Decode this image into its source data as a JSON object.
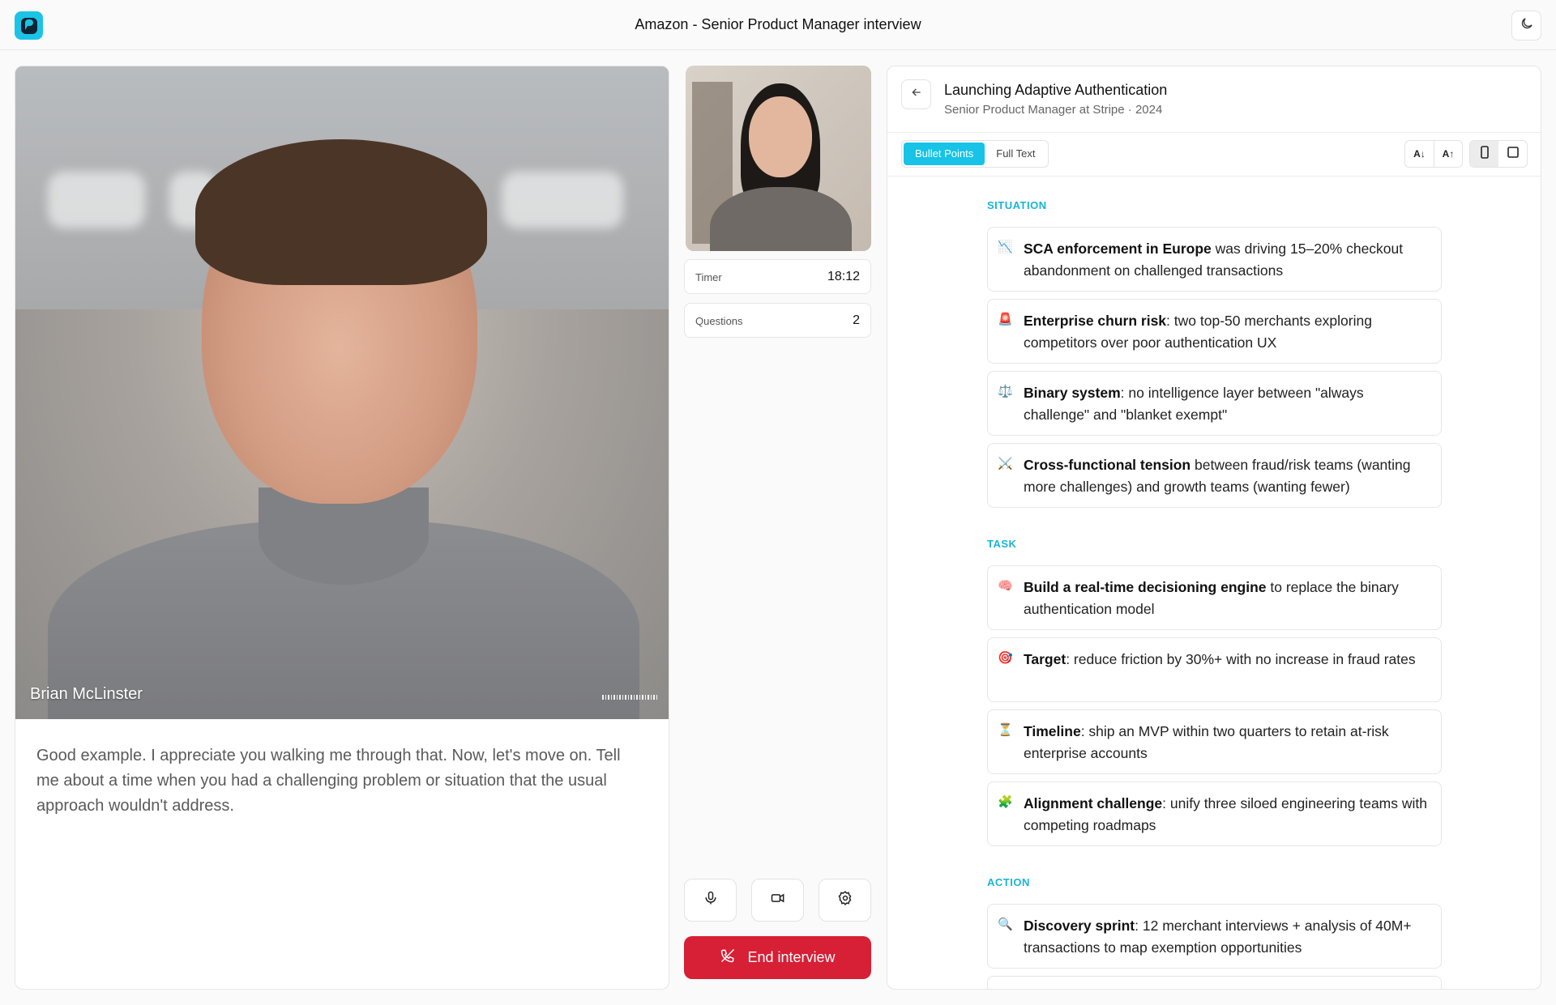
{
  "app": {
    "title": "Amazon - Senior Product Manager interview"
  },
  "interviewer": {
    "name": "Brian McLinster",
    "transcript": "Good example. I appreciate you walking me through that. Now, let's move on. Tell me about a time when you had a challenging problem or situation that the usual approach wouldn't address."
  },
  "stats": {
    "timer_label": "Timer",
    "timer_value": "18:12",
    "questions_label": "Questions",
    "questions_value": "2"
  },
  "controls": {
    "end_label": "End interview"
  },
  "story": {
    "title": "Launching Adaptive Authentication",
    "subtitle": "Senior Product Manager at Stripe · 2024",
    "view_bullets": "Bullet Points",
    "view_full": "Full Text",
    "font_decrease": "A↓",
    "font_increase": "A↑",
    "sections": [
      {
        "label": "SITUATION",
        "items": [
          {
            "emoji": "📉",
            "bold": "SCA enforcement in Europe",
            "text": " was driving 15–20% checkout abandonment on challenged transactions"
          },
          {
            "emoji": "🚨",
            "bold": "Enterprise churn risk",
            "text": ": two top-50 merchants exploring competitors over poor authentication UX"
          },
          {
            "emoji": "⚖️",
            "bold": "Binary system",
            "text": ": no intelligence layer between \"always challenge\" and \"blanket exempt\""
          },
          {
            "emoji": "⚔️",
            "bold": "Cross-functional tension",
            "text": " between fraud/risk teams (wanting more challenges) and growth teams (wanting fewer)"
          }
        ]
      },
      {
        "label": "TASK",
        "items": [
          {
            "emoji": "🧠",
            "bold": "Build a real-time decisioning engine",
            "text": " to replace the binary authentication model"
          },
          {
            "emoji": "🎯",
            "bold": "Target",
            "text": ": reduce friction by 30%+ with no increase in fraud rates"
          },
          {
            "emoji": "⏳",
            "bold": "Timeline",
            "text": ": ship an MVP within two quarters to retain at-risk enterprise accounts"
          },
          {
            "emoji": "🧩",
            "bold": "Alignment challenge",
            "text": ": unify three siloed engineering teams with competing roadmaps"
          }
        ]
      },
      {
        "label": "ACTION",
        "items": [
          {
            "emoji": "🔍",
            "bold": "Discovery sprint",
            "text": ": 12 merchant interviews + analysis of 40M+ transactions to map exemption opportunities"
          }
        ]
      }
    ]
  },
  "icons": {
    "logo": "logo-icon",
    "theme": "moon-icon",
    "back": "arrow-left-icon",
    "mic": "microphone-icon",
    "camera": "video-camera-icon",
    "settings": "gear-icon",
    "end": "phone-off-icon"
  },
  "colors": {
    "accent": "#17c3e6",
    "danger": "#d71f35"
  }
}
